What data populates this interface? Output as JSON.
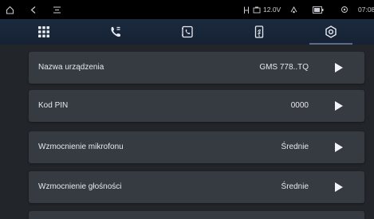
{
  "status_bar": {
    "icons": [
      "home-icon",
      "back-icon",
      "menu-icon",
      "bluetooth-icon",
      "battery-voltage-icon",
      "bluetooth-audio-icon",
      "battery-icon",
      "location-icon"
    ],
    "voltage": "12.0V",
    "time": "07:08"
  },
  "nav": {
    "tabs": [
      {
        "name": "apps-grid-icon",
        "active": false
      },
      {
        "name": "phone-call-icon",
        "active": false
      },
      {
        "name": "phonebook-icon",
        "active": false
      },
      {
        "name": "phone-link-icon",
        "active": false
      },
      {
        "name": "settings-icon",
        "active": true
      }
    ]
  },
  "settings": {
    "rows": [
      {
        "label": "Nazwa urządzenia",
        "value": "GMS 778..TQ"
      },
      {
        "label": "Kod PIN",
        "value": "0000"
      },
      {
        "label": "Wzmocnienie mikrofonu",
        "value": "Średnie"
      },
      {
        "label": "Wzmocnienie głośności",
        "value": "Średnie"
      }
    ]
  },
  "colors": {
    "background": "#202328",
    "row": "#363a41",
    "nav": "#1b2a3e",
    "text": "#e6e8eb"
  }
}
